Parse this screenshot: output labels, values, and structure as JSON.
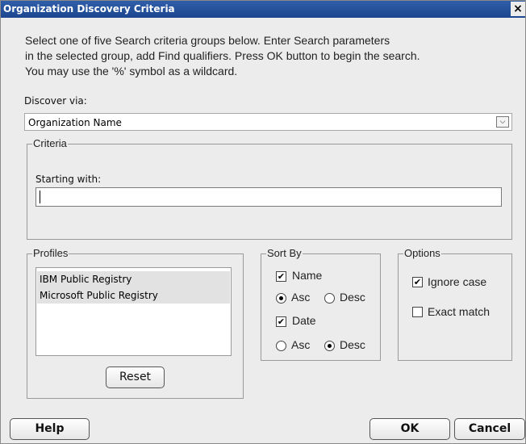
{
  "window": {
    "title": "Organization Discovery Criteria",
    "close_glyph": "×"
  },
  "instructions": [
    "Select one of five Search criteria groups below. Enter Search parameters",
    "in the selected group, add Find qualifiers. Press OK button to begin the search.",
    "You may use the '%' symbol as a wildcard."
  ],
  "discover": {
    "label": "Discover via:",
    "selected": "Organization Name"
  },
  "criteria": {
    "legend": "Criteria",
    "starting_label": "Starting with:",
    "starting_value": ""
  },
  "profiles": {
    "legend": "Profiles",
    "items": [
      "IBM Public Registry",
      "Microsoft Public Registry"
    ],
    "reset_label": "Reset"
  },
  "sort": {
    "legend": "Sort By",
    "name": {
      "label": "Name",
      "checked": true,
      "order": "Asc"
    },
    "date": {
      "label": "Date",
      "checked": true,
      "order": "Desc"
    },
    "asc_label": "Asc",
    "desc_label": "Desc"
  },
  "options": {
    "legend": "Options",
    "ignore_case": {
      "label": "Ignore case",
      "checked": true
    },
    "exact_match": {
      "label": "Exact match",
      "checked": false
    }
  },
  "footer": {
    "help": "Help",
    "ok": "OK",
    "cancel": "Cancel"
  }
}
